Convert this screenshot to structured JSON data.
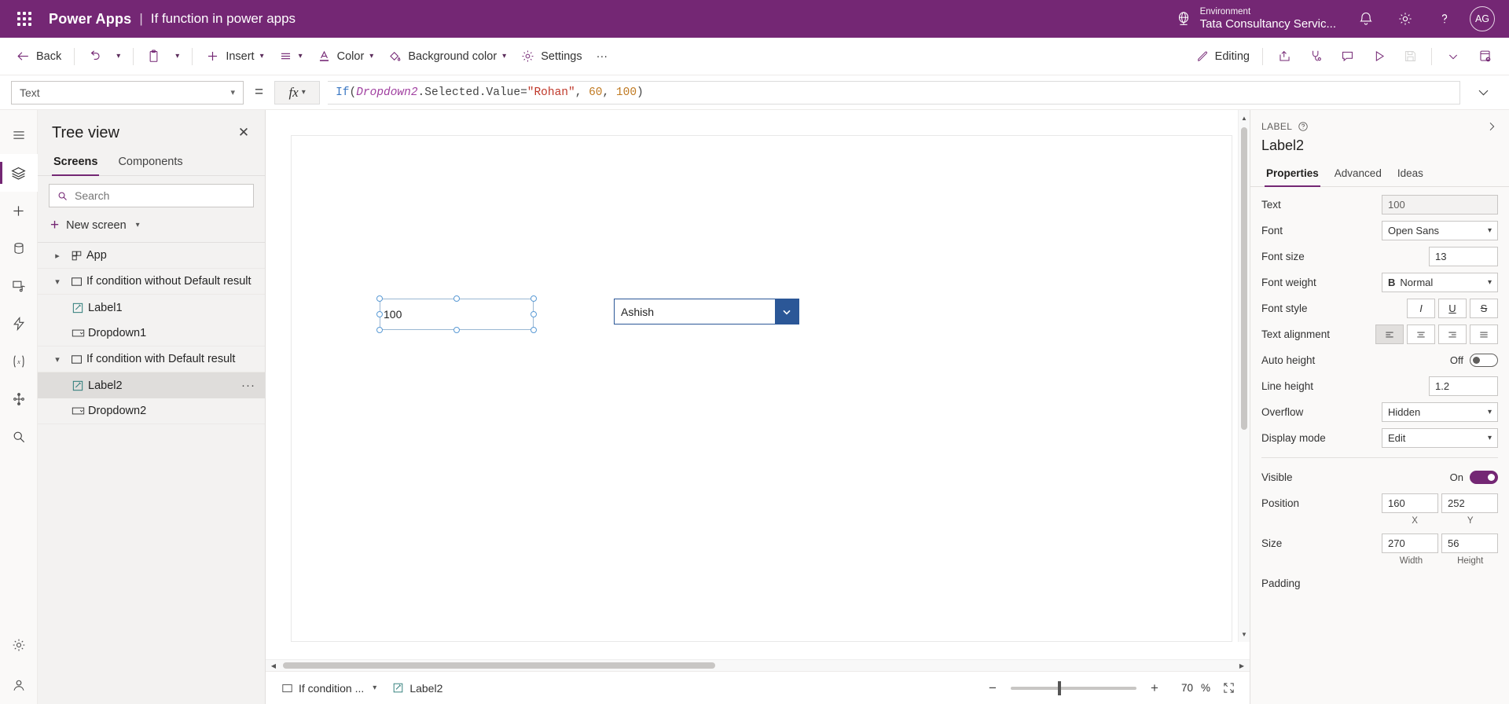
{
  "header": {
    "waffle_icon": "app-launcher-icon",
    "brand": "Power Apps",
    "separator": "|",
    "app_title": "If function in power apps",
    "environment_label": "Environment",
    "environment_value": "Tata Consultancy Servic...",
    "globe_icon": "globe-icon",
    "notification_icon": "bell-icon",
    "settings_icon": "gear-icon",
    "help_icon": "question-icon",
    "avatar_initials": "AG",
    "brand_color": "#742774"
  },
  "toolbar": {
    "back": "Back",
    "undo_icon": "undo-icon",
    "paste_icon": "paste-icon",
    "insert": "Insert",
    "list_icon": "list-icon",
    "color": "Color",
    "background_color": "Background color",
    "settings": "Settings",
    "overflow": "···",
    "editing": "Editing",
    "share_icon": "share-icon",
    "checker_icon": "app-checker-icon",
    "comment_icon": "comment-icon",
    "play_icon": "play-preview-icon",
    "save_icon": "save-icon",
    "chevron_icon": "chevron-down-icon",
    "publish_icon": "publish-icon"
  },
  "formula_bar": {
    "property": "Text",
    "equals": "=",
    "fx": "fx",
    "formula_plain": "If(Dropdown2.Selected.Value=\"Rohan\", 60, 100)",
    "tokens": {
      "fn": "If",
      "open": "(",
      "obj": "Dropdown2",
      "prop": ".Selected.Value=",
      "str": "\"Rohan\"",
      "comma1": ", ",
      "num1": "60",
      "comma2": ", ",
      "num2": "100",
      "close": ")"
    }
  },
  "rail": {
    "items": [
      {
        "name": "hamburger-menu-icon"
      },
      {
        "name": "tree-view-icon",
        "active": true
      },
      {
        "name": "insert-icon"
      },
      {
        "name": "data-icon"
      },
      {
        "name": "media-icon"
      },
      {
        "name": "power-automate-icon"
      },
      {
        "name": "variables-icon"
      },
      {
        "name": "components-icon"
      },
      {
        "name": "search-icon"
      },
      {
        "name": "advanced-settings-icon"
      },
      {
        "name": "account-icon"
      }
    ]
  },
  "tree_panel": {
    "title": "Tree view",
    "close_icon": "close-icon",
    "tabs": [
      {
        "label": "Screens",
        "active": true
      },
      {
        "label": "Components",
        "active": false
      }
    ],
    "search_placeholder": "Search",
    "search_value": "",
    "search_icon": "search-icon",
    "new_screen": "New screen",
    "items": [
      {
        "label": "App",
        "icon": "app-icon",
        "indent": 0,
        "twisty": "collapsed",
        "selected": false
      },
      {
        "label": "If condition without Default result",
        "icon": "screen-icon",
        "indent": 0,
        "twisty": "expanded",
        "selected": false
      },
      {
        "label": "Label1",
        "icon": "label-icon",
        "indent": 1,
        "twisty": "none",
        "selected": false
      },
      {
        "label": "Dropdown1",
        "icon": "dropdown-icon",
        "indent": 1,
        "twisty": "none",
        "selected": false
      },
      {
        "label": "If condition with Default result",
        "icon": "screen-icon",
        "indent": 0,
        "twisty": "expanded",
        "selected": false
      },
      {
        "label": "Label2",
        "icon": "label-icon",
        "indent": 1,
        "twisty": "none",
        "selected": true,
        "menu": "···"
      },
      {
        "label": "Dropdown2",
        "icon": "dropdown-icon",
        "indent": 1,
        "twisty": "none",
        "selected": false
      }
    ]
  },
  "canvas": {
    "label_control": {
      "text": "100",
      "name": "Label2"
    },
    "dropdown_control": {
      "value": "Ashish",
      "name": "Dropdown2",
      "chevron_icon": "chevron-down-icon"
    }
  },
  "statusbar": {
    "screen_crumb": "If condition ...",
    "screen_icon": "screen-icon",
    "control_crumb": "Label2",
    "control_icon": "label-icon",
    "zoom_out_icon": "minus-icon",
    "zoom_in_icon": "plus-icon",
    "zoom_value": "70",
    "zoom_unit": "%",
    "fit_icon": "fit-screen-icon"
  },
  "properties": {
    "kind": "LABEL",
    "help_icon": "help-circle-icon",
    "collapse_icon": "chevron-right-icon",
    "name": "Label2",
    "tabs": [
      {
        "label": "Properties",
        "active": true
      },
      {
        "label": "Advanced",
        "active": false
      },
      {
        "label": "Ideas",
        "active": false
      }
    ],
    "rows": {
      "text_label": "Text",
      "text_value": "100",
      "font_label": "Font",
      "font_value": "Open Sans",
      "font_size_label": "Font size",
      "font_size_value": "13",
      "font_weight_label": "Font weight",
      "font_weight_value": "Normal",
      "font_weight_icon": "bold-icon",
      "font_style_label": "Font style",
      "font_style_italic": "I",
      "font_style_underline": "U",
      "font_style_strike": "S",
      "text_align_label": "Text alignment",
      "auto_height_label": "Auto height",
      "auto_height_state": "Off",
      "line_height_label": "Line height",
      "line_height_value": "1.2",
      "overflow_label": "Overflow",
      "overflow_value": "Hidden",
      "display_mode_label": "Display mode",
      "display_mode_value": "Edit",
      "visible_label": "Visible",
      "visible_state": "On",
      "position_label": "Position",
      "position_x": "160",
      "position_y": "252",
      "position_x_sub": "X",
      "position_y_sub": "Y",
      "size_label": "Size",
      "size_w": "270",
      "size_h": "56",
      "size_w_sub": "Width",
      "size_h_sub": "Height",
      "padding_label": "Padding"
    }
  }
}
